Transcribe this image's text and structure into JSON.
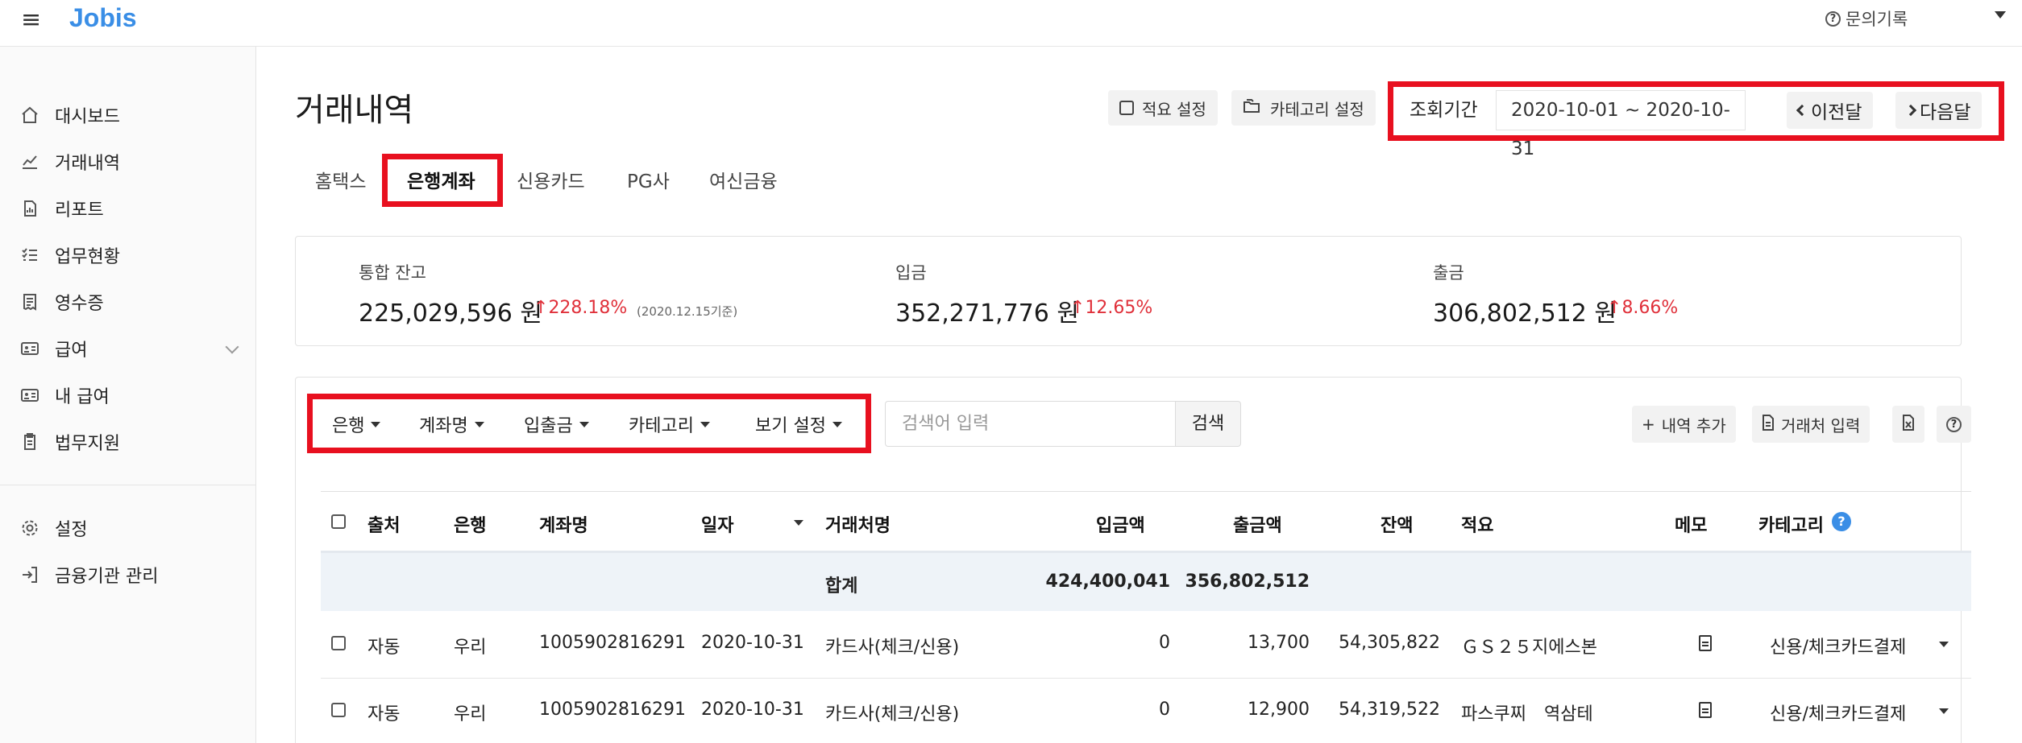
{
  "app": {
    "logo": "Jobis",
    "help_link": "문의기록"
  },
  "sidebar": {
    "items": [
      {
        "label": "대시보드",
        "icon": "home-icon"
      },
      {
        "label": "거래내역",
        "icon": "chart-line-icon"
      },
      {
        "label": "리포트",
        "icon": "report-icon"
      },
      {
        "label": "업무현황",
        "icon": "checklist-icon"
      },
      {
        "label": "영수증",
        "icon": "receipt-icon"
      },
      {
        "label": "급여",
        "icon": "id-card-icon"
      },
      {
        "label": "내 급여",
        "icon": "id-card-icon"
      },
      {
        "label": "법무지원",
        "icon": "clipboard-icon"
      },
      {
        "label": "설정",
        "icon": "gear-icon"
      },
      {
        "label": "금융기관 관리",
        "icon": "login-icon"
      }
    ]
  },
  "header": {
    "title": "거래내역",
    "memo_setting": "적요 설정",
    "category_setting": "카테고리 설정",
    "period_label": "조회기간",
    "period_value": "2020-10-01 ~ 2020-10-31",
    "prev_month": "이전달",
    "next_month": "다음달"
  },
  "tabs": [
    "홈택스",
    "은행계좌",
    "신용카드",
    "PG사",
    "여신금융"
  ],
  "active_tab": "은행계좌",
  "summary": {
    "balance_label": "통합 잔고",
    "balance_value": "225,029,596 원",
    "balance_change": "228.18%",
    "balance_note": "(2020.12.15기준)",
    "deposit_label": "입금",
    "deposit_value": "352,271,776 원",
    "deposit_change": "12.65%",
    "withdraw_label": "출금",
    "withdraw_value": "306,802,512 원",
    "withdraw_change": "8.66%"
  },
  "filters": {
    "bank": "은행",
    "account": "계좌명",
    "inout": "입출금",
    "category": "카테고리",
    "view": "보기 설정",
    "search_placeholder": "검색어 입력",
    "search_button": "검색",
    "add_entry": "내역 추가",
    "input_vendor": "거래처 입력"
  },
  "table": {
    "headers": [
      "출처",
      "은행",
      "계좌명",
      "일자",
      "거래처명",
      "입금액",
      "출금액",
      "잔액",
      "적요",
      "메모",
      "카테고리"
    ],
    "total": {
      "label": "합계",
      "deposit": "424,400,041",
      "withdraw": "356,802,512"
    },
    "rows": [
      {
        "source": "자동",
        "bank": "우리",
        "account": "1005902816291",
        "date": "2020-10-31",
        "vendor": "카드사(체크/신용)",
        "deposit": "0",
        "withdraw": "13,700",
        "balance": "54,305,822",
        "memo": "ＧＳ２５지에스본",
        "category": "신용/체크카드결제"
      },
      {
        "source": "자동",
        "bank": "우리",
        "account": "1005902816291",
        "date": "2020-10-31",
        "vendor": "카드사(체크/신용)",
        "deposit": "0",
        "withdraw": "12,900",
        "balance": "54,319,522",
        "memo": "파스쿠찌　역삼테",
        "category": "신용/체크카드결제"
      }
    ]
  },
  "colors": {
    "brand": "#3a8ee6",
    "highlight": "#e8101f",
    "increase": "#e0303a"
  }
}
